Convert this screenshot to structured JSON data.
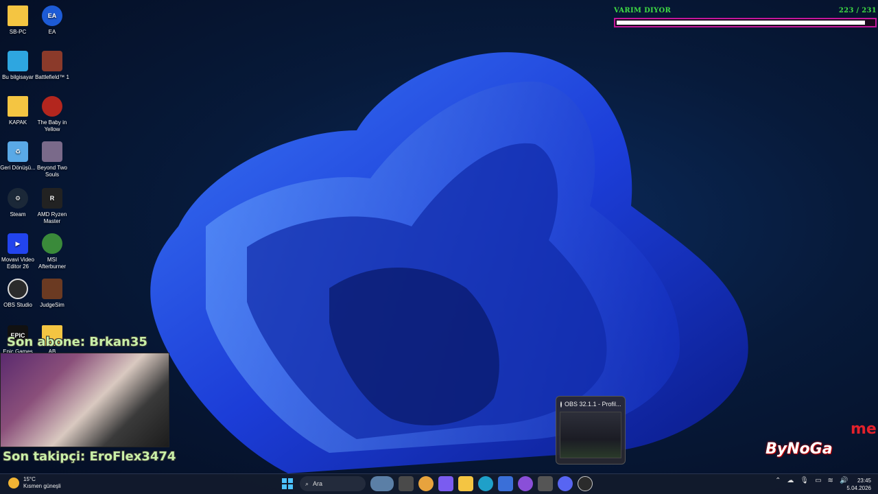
{
  "desktop_icons": [
    {
      "label": "SB-PC",
      "icon": "folder-icon",
      "color": "#f4c542"
    },
    {
      "label": "EA",
      "icon": "ea-app-icon",
      "color": "#1d5bd6"
    },
    {
      "label": "Bu bilgisayar",
      "icon": "monitor-icon",
      "color": "#2ea6e0"
    },
    {
      "label": "Battlefield™ 1",
      "icon": "game-icon",
      "color": "#8b3a2a"
    },
    {
      "label": "KAPAK",
      "icon": "folder-icon",
      "color": "#f4c542"
    },
    {
      "label": "The Baby in Yellow",
      "icon": "game-icon",
      "color": "#b3261e"
    },
    {
      "label": "Geri Dönüşü...",
      "icon": "recycle-bin-icon",
      "color": "#5aa9e6"
    },
    {
      "label": "Beyond Two Souls",
      "icon": "game-icon",
      "color": "#7a6a8a"
    },
    {
      "label": "Steam",
      "icon": "steam-icon",
      "color": "#1b2838"
    },
    {
      "label": "AMD Ryzen Master",
      "icon": "ryzen-icon",
      "color": "#222222"
    },
    {
      "label": "Movavi Video Editor 26",
      "icon": "movavi-icon",
      "color": "#2244ee"
    },
    {
      "label": "MSI Afterburner",
      "icon": "afterburner-icon",
      "color": "#3a8a3a"
    },
    {
      "label": "OBS Studio",
      "icon": "obs-icon",
      "color": "#2b2b2b"
    },
    {
      "label": "JudgeSim",
      "icon": "gavel-icon",
      "color": "#6b3a22"
    },
    {
      "label": "Epic Games",
      "icon": "epic-games-icon",
      "color": "#111111"
    },
    {
      "label": "AB",
      "icon": "folder-icon",
      "color": "#f4c542"
    }
  ],
  "goal": {
    "title": "VARIM DIYOR",
    "count": "223 / 231",
    "progress": 0.965
  },
  "overlay": {
    "last_sub": "Son abone: Brkan35",
    "last_follower": "Son takipçi: EroFlex3474",
    "logo": "ByNoGa",
    "logo_accent": "me"
  },
  "obs_preview": {
    "title": "OBS 32.1.1 - Profil..."
  },
  "taskbar": {
    "weather_temp": "15°C",
    "weather_desc": "Kısmen güneşli",
    "search_placeholder": "Ara",
    "time": "23:45",
    "date": "5.04.2026"
  }
}
